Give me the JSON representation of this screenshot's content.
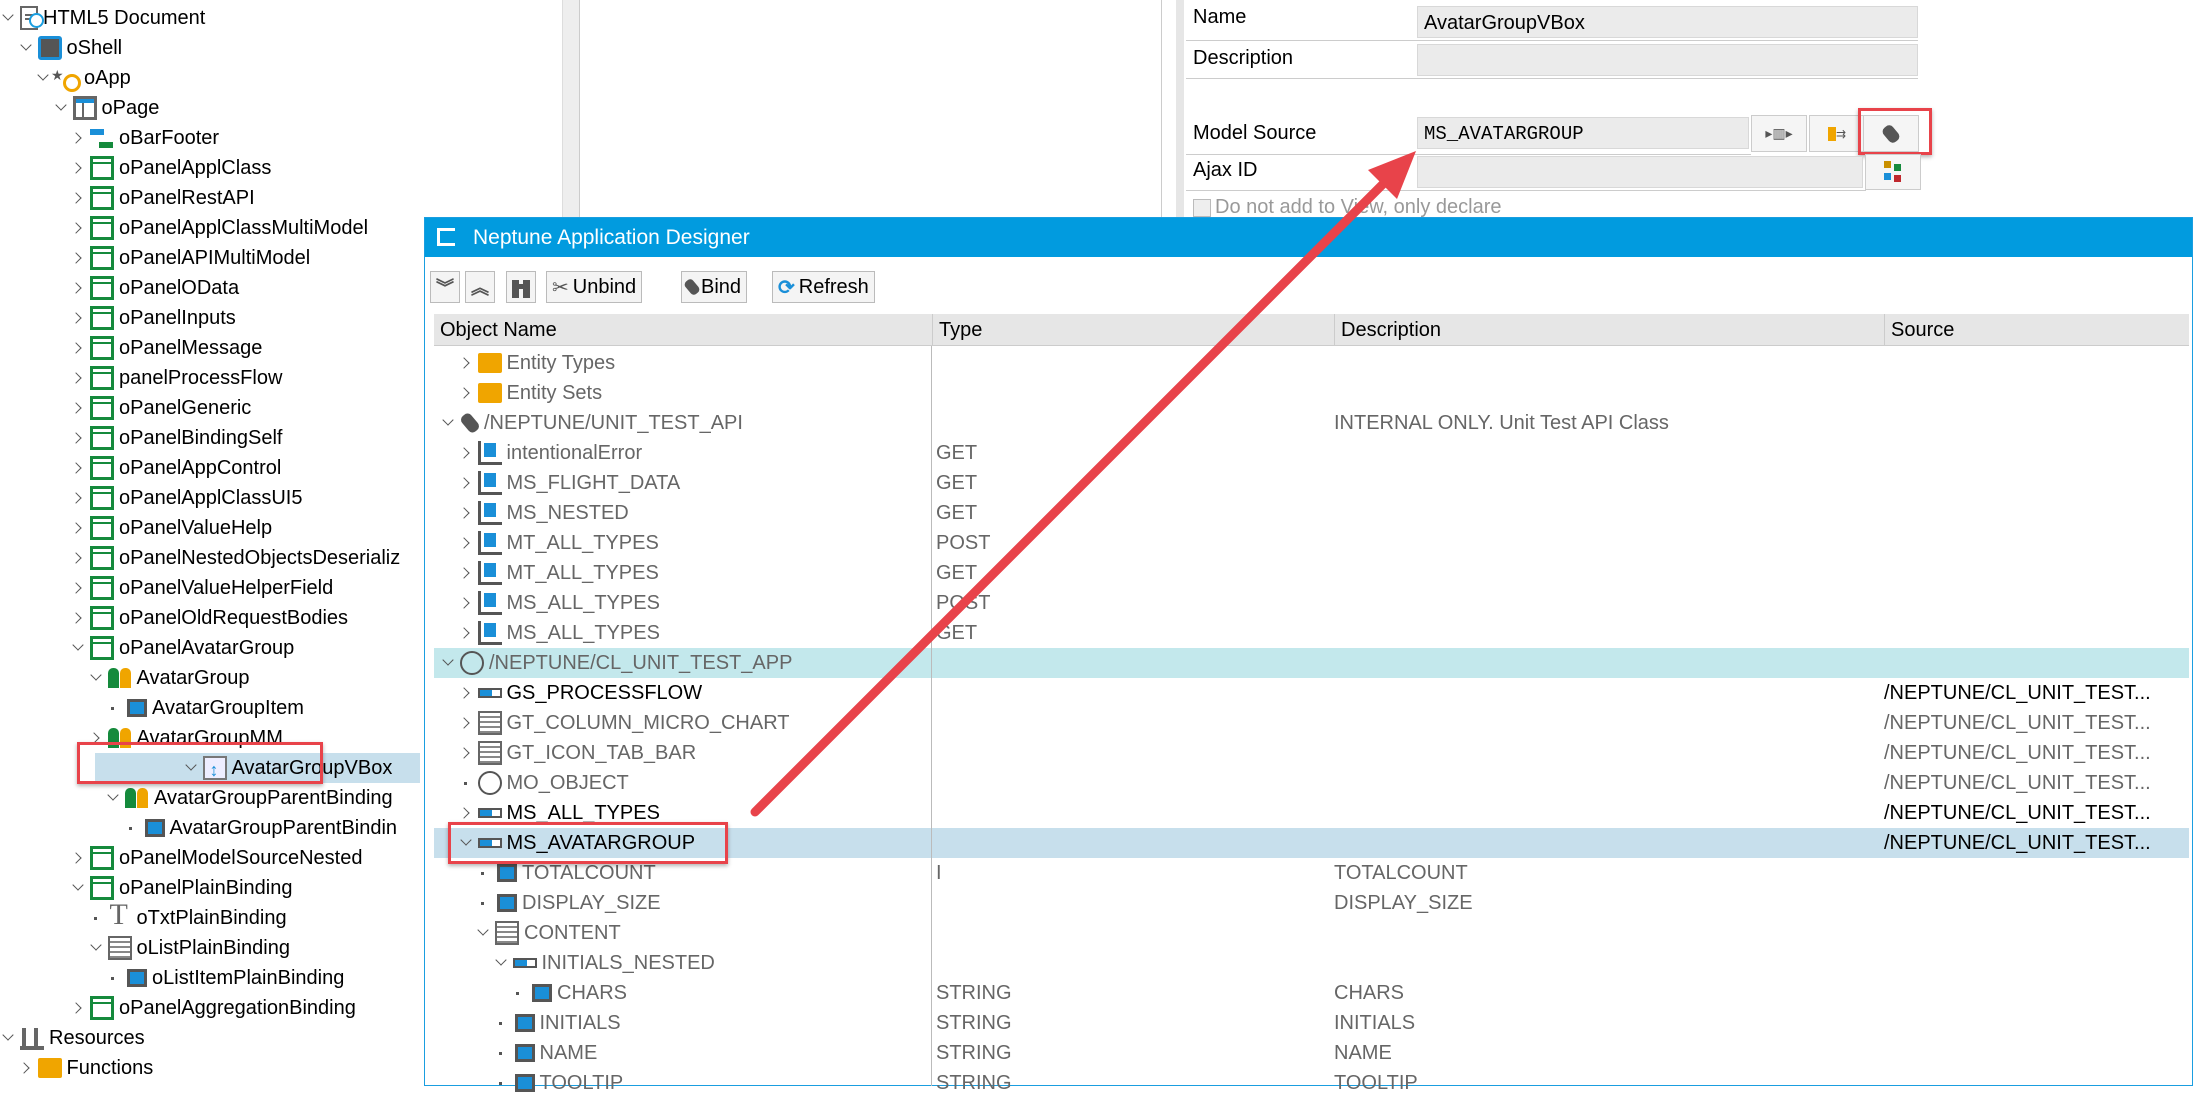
{
  "tree": [
    {
      "label": "HTML5 Document",
      "level": 0,
      "state": "open",
      "icon": "doc"
    },
    {
      "label": "oShell",
      "level": 1,
      "state": "open",
      "icon": "shell"
    },
    {
      "label": "oApp",
      "level": 2,
      "state": "open",
      "icon": "app"
    },
    {
      "label": "oPage",
      "level": 3,
      "state": "open",
      "icon": "page"
    },
    {
      "label": "oBarFooter",
      "level": 4,
      "state": "closed",
      "icon": "bar"
    },
    {
      "label": "oPanelApplClass",
      "level": 4,
      "state": "closed",
      "icon": "panel"
    },
    {
      "label": "oPanelRestAPI",
      "level": 4,
      "state": "closed",
      "icon": "panel"
    },
    {
      "label": "oPanelApplClassMultiModel",
      "level": 4,
      "state": "closed",
      "icon": "panel"
    },
    {
      "label": "oPanelAPIMultiModel",
      "level": 4,
      "state": "closed",
      "icon": "panel"
    },
    {
      "label": "oPanelOData",
      "level": 4,
      "state": "closed",
      "icon": "panel"
    },
    {
      "label": "oPanelInputs",
      "level": 4,
      "state": "closed",
      "icon": "panel"
    },
    {
      "label": "oPanelMessage",
      "level": 4,
      "state": "closed",
      "icon": "panel"
    },
    {
      "label": "panelProcessFlow",
      "level": 4,
      "state": "closed",
      "icon": "panel"
    },
    {
      "label": "oPanelGeneric",
      "level": 4,
      "state": "closed",
      "icon": "panel"
    },
    {
      "label": "oPanelBindingSelf",
      "level": 4,
      "state": "closed",
      "icon": "panel"
    },
    {
      "label": "oPanelAppControl",
      "level": 4,
      "state": "closed",
      "icon": "panel"
    },
    {
      "label": "oPanelApplClassUI5",
      "level": 4,
      "state": "closed",
      "icon": "panel"
    },
    {
      "label": "oPanelValueHelp",
      "level": 4,
      "state": "closed",
      "icon": "panel"
    },
    {
      "label": "oPanelNestedObjectsDeserializ",
      "level": 4,
      "state": "closed",
      "icon": "panel"
    },
    {
      "label": "oPanelValueHelperField",
      "level": 4,
      "state": "closed",
      "icon": "panel"
    },
    {
      "label": "oPanelOldRequestBodies",
      "level": 4,
      "state": "closed",
      "icon": "panel"
    },
    {
      "label": "oPanelAvatarGroup",
      "level": 4,
      "state": "open",
      "icon": "panel"
    },
    {
      "label": "AvatarGroup",
      "level": 5,
      "state": "open",
      "icon": "avg"
    },
    {
      "label": "AvatarGroupItem",
      "level": 6,
      "state": "leaf",
      "icon": "item"
    },
    {
      "label": "AvatarGroupMM",
      "level": 5,
      "state": "closed",
      "icon": "avg"
    },
    {
      "label": "AvatarGroupVBox",
      "level": 5,
      "state": "open",
      "icon": "vbox",
      "selected": true
    },
    {
      "label": "AvatarGroupParentBinding",
      "level": 6,
      "state": "open",
      "icon": "avg"
    },
    {
      "label": "AvatarGroupParentBindin",
      "level": 7,
      "state": "leaf",
      "icon": "item"
    },
    {
      "label": "oPanelModelSourceNested",
      "level": 4,
      "state": "closed",
      "icon": "panel"
    },
    {
      "label": "oPanelPlainBinding",
      "level": 4,
      "state": "open",
      "icon": "panel"
    },
    {
      "label": "oTxtPlainBinding",
      "level": 5,
      "state": "leaf",
      "icon": "text"
    },
    {
      "label": "oListPlainBinding",
      "level": 5,
      "state": "open",
      "icon": "list"
    },
    {
      "label": "oListItemPlainBinding",
      "level": 6,
      "state": "leaf",
      "icon": "item"
    },
    {
      "label": "oPanelAggregationBinding",
      "level": 4,
      "state": "closed",
      "icon": "panel"
    },
    {
      "label": "Resources",
      "level": 0,
      "state": "open",
      "icon": "res"
    },
    {
      "label": "Functions",
      "level": 1,
      "state": "closed",
      "icon": "folder"
    }
  ],
  "properties": {
    "name_label": "Name",
    "name_value": "AvatarGroupVBox",
    "description_label": "Description",
    "description_value": "",
    "model_source_label": "Model Source",
    "model_source_value": "MS_AVATARGROUP",
    "ajax_id_label": "Ajax ID",
    "ajax_id_value": "",
    "checkbox_label": "Do not add to View, only declare"
  },
  "dialog": {
    "title": "Neptune Application Designer",
    "toolbar": {
      "unbind": "Unbind",
      "bind": "Bind",
      "refresh": "Refresh"
    },
    "columns": [
      "Object Name",
      "Type",
      "Description",
      "Source"
    ],
    "rows": [
      {
        "name": "Entity Types",
        "level": 1,
        "state": "closed",
        "icon": "folder",
        "type": "",
        "desc": "",
        "source": ""
      },
      {
        "name": "Entity Sets",
        "level": 1,
        "state": "closed",
        "icon": "folder",
        "type": "",
        "desc": "",
        "source": ""
      },
      {
        "name": "/NEPTUNE/UNIT_TEST_API",
        "level": 0,
        "state": "open",
        "icon": "plug",
        "type": "",
        "desc": "INTERNAL ONLY. Unit Test API Class",
        "source": ""
      },
      {
        "name": "intentionalError",
        "level": 1,
        "state": "closed",
        "icon": "method",
        "type": "GET",
        "desc": "",
        "source": ""
      },
      {
        "name": "MS_FLIGHT_DATA",
        "level": 1,
        "state": "closed",
        "icon": "method",
        "type": "GET",
        "desc": "",
        "source": ""
      },
      {
        "name": "MS_NESTED",
        "level": 1,
        "state": "closed",
        "icon": "method",
        "type": "GET",
        "desc": "",
        "source": ""
      },
      {
        "name": "MT_ALL_TYPES",
        "level": 1,
        "state": "closed",
        "icon": "method",
        "type": "POST",
        "desc": "",
        "source": ""
      },
      {
        "name": "MT_ALL_TYPES",
        "level": 1,
        "state": "closed",
        "icon": "method",
        "type": "GET",
        "desc": "",
        "source": ""
      },
      {
        "name": "MS_ALL_TYPES",
        "level": 1,
        "state": "closed",
        "icon": "method",
        "type": "POST",
        "desc": "",
        "source": ""
      },
      {
        "name": "MS_ALL_TYPES",
        "level": 1,
        "state": "closed",
        "icon": "method",
        "type": "GET",
        "desc": "",
        "source": ""
      },
      {
        "name": "/NEPTUNE/CL_UNIT_TEST_APP",
        "level": 0,
        "state": "open",
        "icon": "circle",
        "type": "",
        "desc": "",
        "source": "",
        "style": "teal"
      },
      {
        "name": "GS_PROCESSFLOW",
        "level": 1,
        "state": "closed",
        "icon": "struct",
        "type": "",
        "desc": "",
        "source": "/NEPTUNE/CL_UNIT_TEST...",
        "style": "blk"
      },
      {
        "name": "GT_COLUMN_MICRO_CHART",
        "level": 1,
        "state": "closed",
        "icon": "table",
        "type": "",
        "desc": "",
        "source": "/NEPTUNE/CL_UNIT_TEST..."
      },
      {
        "name": "GT_ICON_TAB_BAR",
        "level": 1,
        "state": "closed",
        "icon": "table",
        "type": "",
        "desc": "",
        "source": "/NEPTUNE/CL_UNIT_TEST..."
      },
      {
        "name": "MO_OBJECT",
        "level": 1,
        "state": "leaf",
        "icon": "circle",
        "type": "",
        "desc": "",
        "source": "/NEPTUNE/CL_UNIT_TEST..."
      },
      {
        "name": "MS_ALL_TYPES",
        "level": 1,
        "state": "closed",
        "icon": "struct",
        "type": "",
        "desc": "",
        "source": "/NEPTUNE/CL_UNIT_TEST...",
        "style": "blk"
      },
      {
        "name": "MS_AVATARGROUP",
        "level": 1,
        "state": "open",
        "icon": "struct",
        "type": "",
        "desc": "",
        "source": "/NEPTUNE/CL_UNIT_TEST...",
        "style": "sel blk"
      },
      {
        "name": "TOTALCOUNT",
        "level": 2,
        "state": "leaf",
        "icon": "field",
        "type": "I",
        "desc": "TOTALCOUNT",
        "source": ""
      },
      {
        "name": "DISPLAY_SIZE",
        "level": 2,
        "state": "leaf",
        "icon": "field",
        "type": "",
        "desc": "DISPLAY_SIZE",
        "source": ""
      },
      {
        "name": "CONTENT",
        "level": 2,
        "state": "open",
        "icon": "table",
        "type": "",
        "desc": "",
        "source": ""
      },
      {
        "name": "INITIALS_NESTED",
        "level": 3,
        "state": "open",
        "icon": "struct",
        "type": "",
        "desc": "",
        "source": ""
      },
      {
        "name": "CHARS",
        "level": 4,
        "state": "leaf",
        "icon": "field",
        "type": "STRING",
        "desc": "CHARS",
        "source": ""
      },
      {
        "name": "INITIALS",
        "level": 3,
        "state": "leaf",
        "icon": "field",
        "type": "STRING",
        "desc": "INITIALS",
        "source": ""
      },
      {
        "name": "NAME",
        "level": 3,
        "state": "leaf",
        "icon": "field",
        "type": "STRING",
        "desc": "NAME",
        "source": ""
      },
      {
        "name": "TOOLTIP",
        "level": 3,
        "state": "leaf",
        "icon": "field",
        "type": "STRING",
        "desc": "TOOLTIP",
        "source": ""
      }
    ]
  },
  "colors": {
    "accent": "#019bdf",
    "highlight": "#e8434a",
    "selected": "#c7dfec",
    "teal": "#c3e8ec"
  }
}
